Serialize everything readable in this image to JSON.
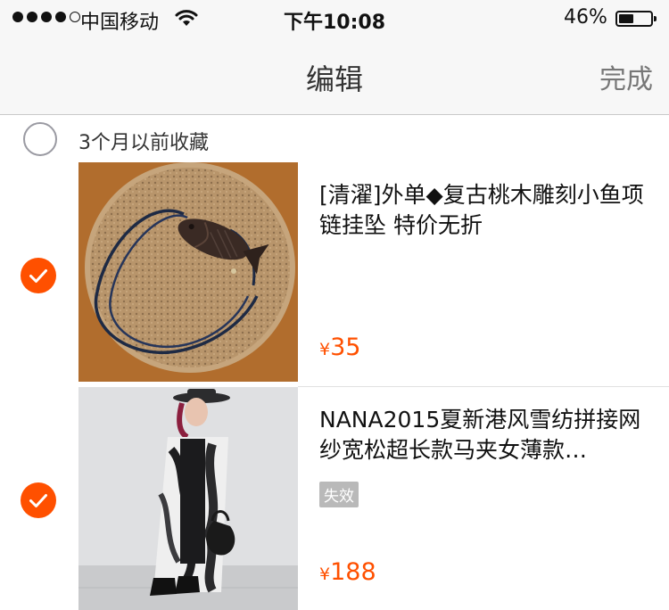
{
  "status_bar": {
    "carrier": "中国移动",
    "time": "下午10:08",
    "battery_percent": "46%",
    "battery_level": 0.46
  },
  "nav": {
    "title": "编辑",
    "done_label": "完成"
  },
  "section": {
    "label": "3个月以前收藏",
    "selected": false
  },
  "items": [
    {
      "title": "[清濯]外单◆复古桃木雕刻小鱼项链挂坠 特价无折",
      "currency": "¥",
      "price": "35",
      "selected": true,
      "image": "wooden-fish-necklace-on-cork"
    },
    {
      "title": "NANA2015夏新港风雪纺拼接网纱宽松超长款马夹女薄款…",
      "currency": "¥",
      "price": "188",
      "badge": "失效",
      "selected": true,
      "image": "woman-in-tie-dye-long-vest"
    }
  ],
  "colors": {
    "accent": "#ff5000",
    "bar_bg": "#f7f7f7",
    "badge_bg": "#b9b9b9"
  }
}
